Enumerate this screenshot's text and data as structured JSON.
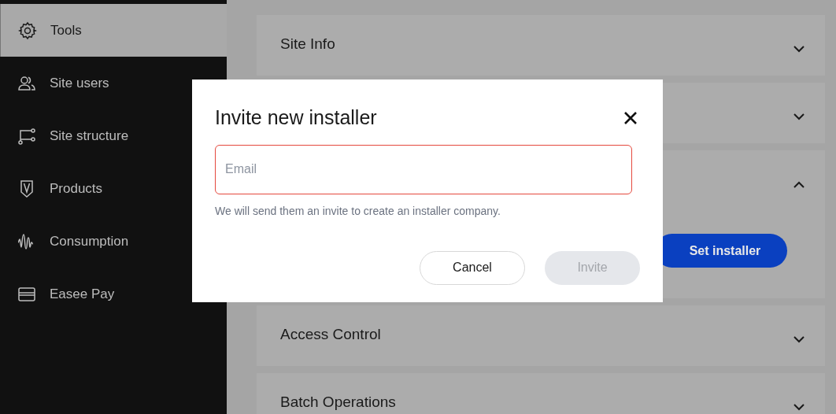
{
  "sidebar": {
    "items": [
      {
        "label": "Tools",
        "kind": "gear",
        "selected": true
      },
      {
        "label": "Site users",
        "kind": "users",
        "selected": false
      },
      {
        "label": "Site structure",
        "kind": "structure",
        "selected": false
      },
      {
        "label": "Products",
        "kind": "shield",
        "selected": false
      },
      {
        "label": "Consumption",
        "kind": "wave",
        "selected": false
      },
      {
        "label": "Easee Pay",
        "kind": "card",
        "selected": false
      }
    ]
  },
  "sections": [
    {
      "title": "Site Info",
      "expanded": false
    },
    {
      "expanded": false
    },
    {
      "expanded": true,
      "button": "Set installer"
    },
    {
      "title": "Access Control",
      "expanded": false
    },
    {
      "title": "Batch Operations",
      "expanded": false
    }
  ],
  "dialog": {
    "title": "Invite new installer",
    "email": {
      "placeholder": "Email",
      "invalid": true
    },
    "helper": "We will send them an invite to create an installer company.",
    "buttons": [
      {
        "label": "Cancel",
        "disabled": false
      },
      {
        "label": "Invite",
        "disabled": true
      }
    ]
  }
}
